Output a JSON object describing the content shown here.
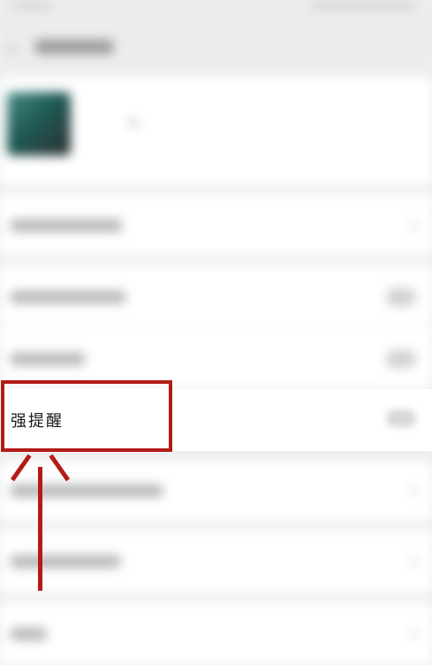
{
  "highlighted_setting": {
    "label": "强提醒"
  },
  "colors": {
    "annotation": "#b31b16",
    "background": "#efefef",
    "card": "#ffffff"
  },
  "icons": {
    "back": "back-arrow-icon",
    "annotation_arrow": "up-arrow-icon"
  }
}
